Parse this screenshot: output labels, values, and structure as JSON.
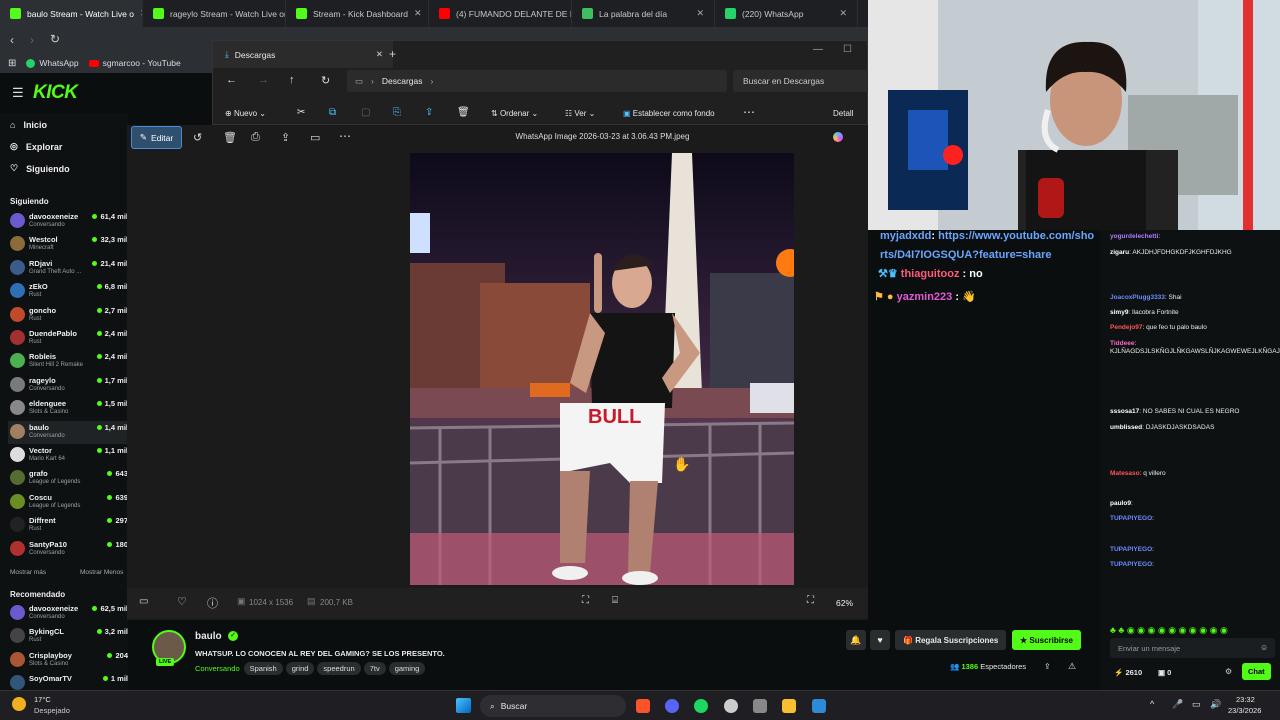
{
  "browser": {
    "tabs": [
      {
        "title": "baulo Stream - Watch Live o",
        "color": "#53fc18",
        "active": true
      },
      {
        "title": "rageylo Stream - Watch Live on",
        "color": "#53fc18",
        "active": false
      },
      {
        "title": "Stream - Kick Dashboard",
        "color": "#53fc18",
        "active": false
      },
      {
        "title": "(4) FUMANDO DELANTE DE M",
        "color": "#ff0000",
        "active": false
      },
      {
        "title": "La palabra del día",
        "color": "#3fbf5f",
        "active": false
      },
      {
        "title": "(220) WhatsApp",
        "color": "#25d366",
        "active": false
      }
    ],
    "bookmarks": [
      "WhatsApp",
      "sgmarcoo - YouTube"
    ]
  },
  "kick": {
    "logo": "KICK",
    "nav": [
      "Inicio",
      "Explorar",
      "Siguiendo"
    ],
    "following_header": "Siguiendo",
    "following": [
      {
        "name": "davooxeneize",
        "game": "Conversando",
        "viewers": "61,4 mil",
        "color": "#6a5acd"
      },
      {
        "name": "Westcol",
        "game": "Minecraft",
        "viewers": "32,3 mil",
        "color": "#8b6b3a"
      },
      {
        "name": "RDjavi",
        "game": "Grand Theft Auto ...",
        "viewers": "21,4 mil",
        "color": "#3b5b8a"
      },
      {
        "name": "zEkO",
        "game": "Rust",
        "viewers": "6,8 mil",
        "color": "#2f6fb5"
      },
      {
        "name": "goncho",
        "game": "Rust",
        "viewers": "2,7 mil",
        "color": "#c04a2a"
      },
      {
        "name": "DuendePablo",
        "game": "Rust",
        "viewers": "2,4 mil",
        "color": "#a33030"
      },
      {
        "name": "Robleis",
        "game": "Silent Hill 2 Remake",
        "viewers": "2,4 mil",
        "color": "#4caf50"
      },
      {
        "name": "rageylo",
        "game": "Conversando",
        "viewers": "1,7 mil",
        "color": "#7a7a7a"
      },
      {
        "name": "eldenguee",
        "game": "Slots & Casino",
        "viewers": "1,5 mil",
        "color": "#888"
      },
      {
        "name": "baulo",
        "game": "Conversando",
        "viewers": "1,4 mil",
        "color": "#a08060"
      },
      {
        "name": "Vector",
        "game": "Mario Kart 64",
        "viewers": "1,1 mil",
        "color": "#ddd"
      },
      {
        "name": "grafo",
        "game": "League of Legends",
        "viewers": "643",
        "color": "#556b2f"
      },
      {
        "name": "Coscu",
        "game": "League of Legends",
        "viewers": "639",
        "color": "#6b8e23"
      },
      {
        "name": "Diffrent",
        "game": "Rust",
        "viewers": "297",
        "color": "#222"
      },
      {
        "name": "SantyPa10",
        "game": "Conversando",
        "viewers": "180",
        "color": "#b03030"
      }
    ],
    "show_more": "Mostrar más",
    "show_less": "Mostrar Menos",
    "recommended_header": "Recomendado",
    "recommended": [
      {
        "name": "davooxeneize",
        "game": "Conversando",
        "viewers": "62,5 mil",
        "color": "#6a5acd"
      },
      {
        "name": "BykingCL",
        "game": "Rust",
        "viewers": "3,2 mil",
        "color": "#444"
      },
      {
        "name": "Crisplayboy",
        "game": "Slots & Casino",
        "viewers": "204",
        "color": "#aa5533"
      },
      {
        "name": "SoyOmarTV",
        "game": "",
        "viewers": "1 mil",
        "color": "#335577"
      }
    ]
  },
  "explorer": {
    "tab_title": "Descargas",
    "path": "Descargas",
    "search_placeholder": "Buscar en Descargas",
    "toolbar": {
      "new": "Nuevo",
      "sort": "Ordenar",
      "view": "Ver",
      "set_bg": "Establecer como fondo",
      "details": "Detall"
    }
  },
  "photos": {
    "edit": "Editar",
    "filename": "WhatsApp Image 2026-03-23 at 3.06.43 PM.jpeg",
    "dimensions": "1024 x 1536",
    "filesize": "200,7 KB",
    "zoom": "62%",
    "zoom_level": 0.15
  },
  "stream": {
    "streamer": "baulo",
    "title": "WHATSUP. LO CONOCEN AL REY DEL GAMING? SE LOS PRESENTO.",
    "category": "Conversando",
    "tags": [
      "Spanish",
      "grind",
      "speedrun",
      "7tv",
      "gaming"
    ],
    "live_badge": "LIVE",
    "gift_button": "Regala Suscripciones",
    "subscribe_button": "Suscribirse",
    "viewers": "1386",
    "viewers_label": "Espectadores"
  },
  "overlay_chat": [
    {
      "user": "myjadxdd",
      "text": "https://www.youtube.com/shorts/D4I7IOGSQUA?feature=share",
      "color": "#6aa6ff"
    },
    {
      "user": "thiaguitooz",
      "text": "no",
      "color": "#ff5a7a"
    },
    {
      "user": "yazmin223",
      "text": "👋",
      "color": "#e05ad6"
    }
  ],
  "chat": {
    "messages": [
      {
        "user": "yogurdelechetti",
        "text": "",
        "color": "#b07aff"
      },
      {
        "user": "zigaru",
        "text": "AKJDHJFDHGKDFJKGHFDJKHG",
        "color": "#ffffff"
      },
      {
        "user": "JoacoxPlugg3333",
        "text": "Shai",
        "color": "#6a8cff"
      },
      {
        "user": "simy9",
        "text": "llacobra Fortnite",
        "color": "#ffffff"
      },
      {
        "user": "Pendejo97",
        "text": "que feo tu palo baulo",
        "color": "#ff5555"
      },
      {
        "user": "Tiddeee",
        "text": "KJLÑAGDSJLSKÑGJLÑKGAWSLÑJKAGWEWEJLKÑGAJKLÑGAAGW",
        "color": "#ff66cc"
      },
      {
        "user": "sssosa17",
        "text": "NO SABES NI CUAL ES NEGRO",
        "color": "#ffffff"
      },
      {
        "user": "umblissed",
        "text": "DJASKDJASKDSADAS",
        "color": "#ffffff"
      },
      {
        "user": "Matesaso",
        "text": "q villero",
        "color": "#ff5555"
      },
      {
        "user": "paulo9",
        "text": "",
        "color": "#ffffff"
      },
      {
        "user": "TUPAPIYEGO",
        "text": "",
        "color": "#6a8cff"
      },
      {
        "user": "TUPAPIYEGO",
        "text": "",
        "color": "#6a8cff"
      },
      {
        "user": "TUPAPIYEGO",
        "text": "",
        "color": "#6a8cff"
      }
    ],
    "input_placeholder": "Enviar un mensaje",
    "points": "2610",
    "credits": "0",
    "chat_button": "Chat"
  },
  "taskbar": {
    "weather_temp": "17°C",
    "weather_desc": "Despejado",
    "search": "Buscar",
    "time": "23:32",
    "date": "23/3/2026"
  }
}
